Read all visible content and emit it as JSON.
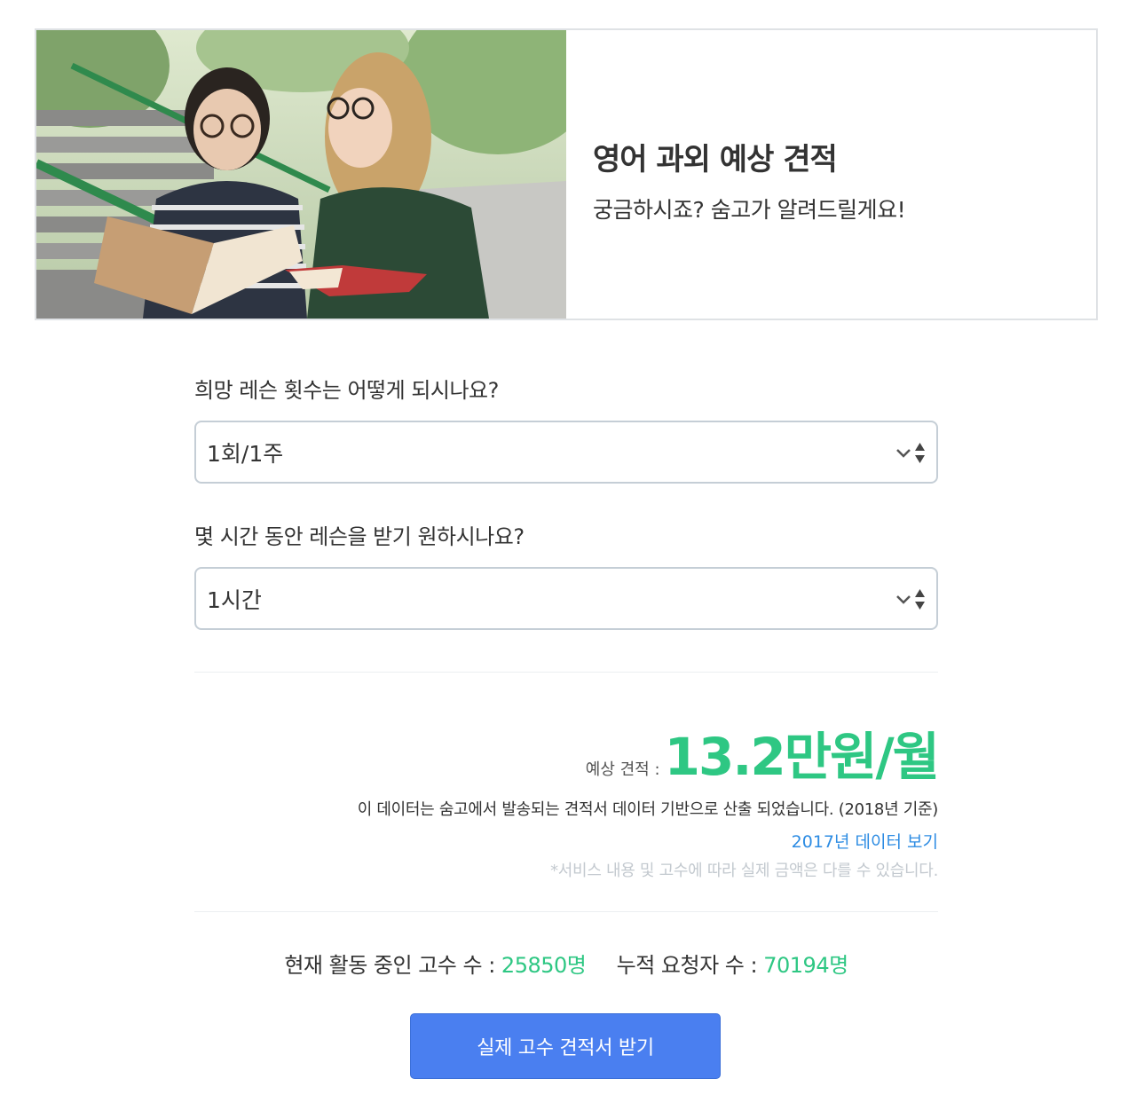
{
  "banner": {
    "title": "영어 과외 예상 견적",
    "subtitle": "궁금하시죠? 숨고가 알려드릴게요!"
  },
  "form": {
    "question1": "희망 레슨 횟수는 어떻게 되시나요?",
    "select1_value": "1회/1주",
    "question2": "몇 시간 동안 레슨을 받기 원하시나요?",
    "select2_value": "1시간"
  },
  "estimate": {
    "label": "예상 견적 :",
    "value": "13.2만원/월",
    "note": "이 데이터는 숨고에서 발송되는 견적서 데이터 기반으로 산출 되었습니다. (2018년 기준)",
    "link": "2017년 데이터 보기",
    "disclaimer": "*서비스 내용 및 고수에 따라 실제 금액은 다를 수 있습니다."
  },
  "stats": {
    "active_label": "현재 활동 중인 고수 수 :",
    "active_value": "25850명",
    "requests_label": "누적 요청자 수 :",
    "requests_value": "70194명"
  },
  "cta": {
    "label": "실제 고수 견적서 받기"
  },
  "colors": {
    "accent_green": "#2ec783",
    "link_blue": "#2d8ce3",
    "button_blue": "#4a7ff0"
  }
}
